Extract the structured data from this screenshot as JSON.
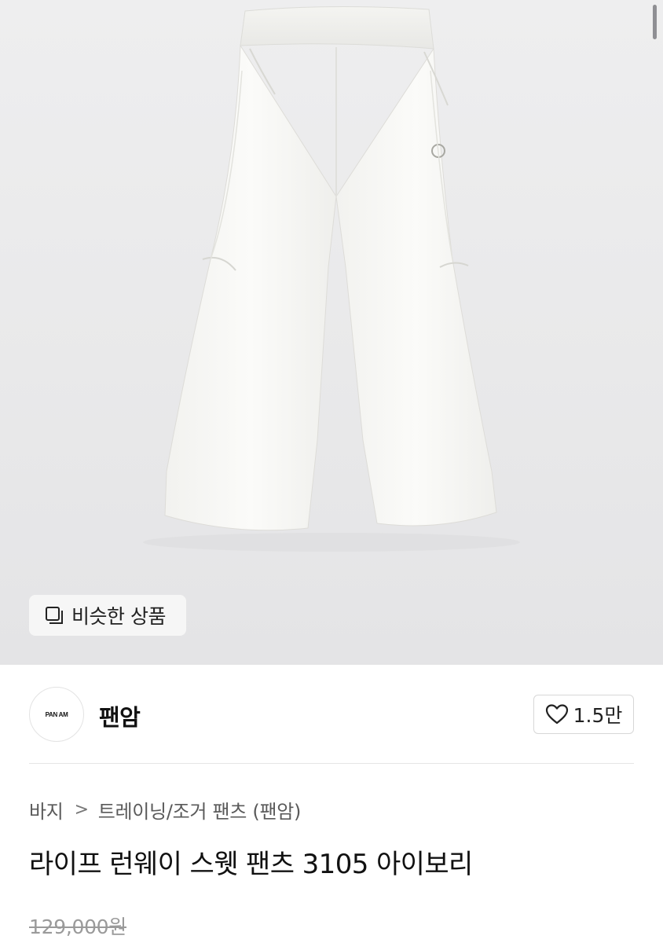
{
  "hero": {
    "similar_label": "비슷한 상품"
  },
  "brand": {
    "logo_text": "PAN AM",
    "name": "팬암",
    "like_count": "1.5만"
  },
  "breadcrumb": {
    "level1": "바지",
    "separator": ">",
    "level2": "트레이닝/조거 팬츠 (팬암)"
  },
  "product": {
    "title": "라이프 런웨이 스웻 팬츠 3105 아이보리",
    "original_price": "129,000원"
  },
  "icons": [
    "similar-items-icon",
    "heart-icon",
    "chevron-right-icon"
  ],
  "colors": {
    "price_struck": "#9a9a9a",
    "hero_bg": "#eaeaeb"
  }
}
